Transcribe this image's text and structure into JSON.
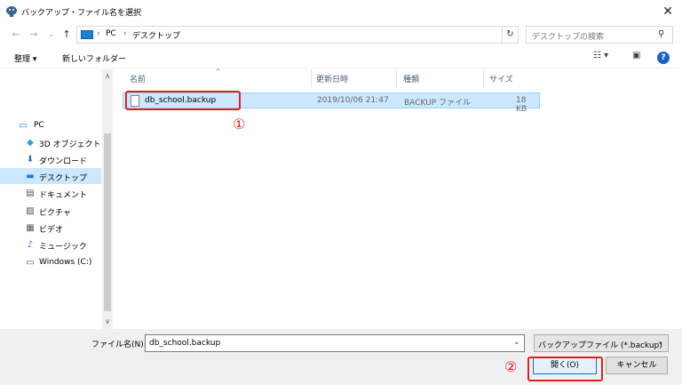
{
  "window": {
    "title": "バックアップ・ファイル名を選択",
    "close_glyph": "✕"
  },
  "address": {
    "parts": [
      "PC",
      "デスクトップ"
    ],
    "separator": "›",
    "search_placeholder": "デスクトップの検索"
  },
  "toolbar": {
    "organize_label": "整理 ▾",
    "new_folder_label": "新しいフォルダー",
    "help_label": "?"
  },
  "sidebar": {
    "items": [
      {
        "label": "PC",
        "icon": "pc-icon"
      },
      {
        "label": "3D オブジェクト",
        "icon": "3d-objects-icon"
      },
      {
        "label": "ダウンロード",
        "icon": "download-icon"
      },
      {
        "label": "デスクトップ",
        "icon": "desktop-icon",
        "selected": true
      },
      {
        "label": "ドキュメント",
        "icon": "document-icon"
      },
      {
        "label": "ピクチャ",
        "icon": "pictures-icon"
      },
      {
        "label": "ビデオ",
        "icon": "video-icon"
      },
      {
        "label": "ミュージック",
        "icon": "music-icon"
      },
      {
        "label": "Windows (C:)",
        "icon": "drive-icon"
      }
    ]
  },
  "files": {
    "columns": [
      "名前",
      "更新日時",
      "種類",
      "サイズ"
    ],
    "rows": [
      {
        "name": "db_school.backup",
        "modified": "2019/10/06 21:47",
        "type": "BACKUP ファイル",
        "size": "18 KB"
      }
    ]
  },
  "annotations": {
    "step1": "①",
    "step2": "②",
    "color": "#e02020"
  },
  "footer": {
    "filename_label": "ファイル名(N):",
    "filename_value": "db_school.backup",
    "filetype_value": "バックアップファイル (*.backup)",
    "open_label": "開く(O)",
    "cancel_label": "キャンセル"
  }
}
